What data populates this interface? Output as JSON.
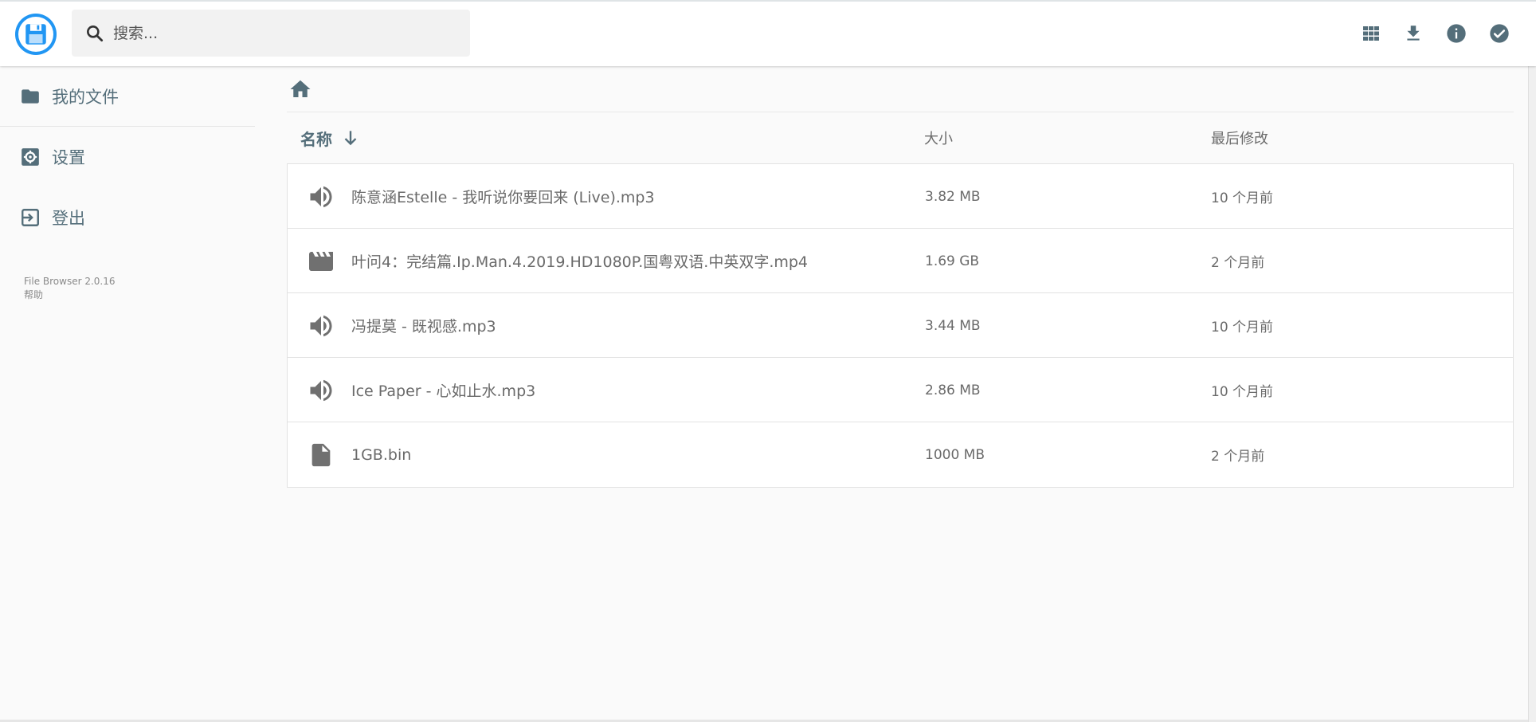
{
  "header": {
    "search_placeholder": "搜索...",
    "actions": [
      {
        "icon": "grid-view-icon"
      },
      {
        "icon": "download-icon"
      },
      {
        "icon": "info-icon"
      },
      {
        "icon": "check-circle-icon"
      }
    ],
    "accent_color": "#2196f3"
  },
  "sidebar": {
    "items": [
      {
        "label": "我的文件",
        "icon": "folder-icon"
      },
      {
        "label": "设置",
        "icon": "settings-icon"
      },
      {
        "label": "登出",
        "icon": "logout-icon"
      }
    ],
    "version": "File Browser 2.0.16",
    "help": "帮助"
  },
  "columns": {
    "name": "名称",
    "size": "大小",
    "modified": "最后修改"
  },
  "files": [
    {
      "name": "陈意涵Estelle - 我听说你要回来 (Live).mp3",
      "size": "3.82 MB",
      "modified": "10 个月前",
      "icon": "audio-icon"
    },
    {
      "name": "叶问4：完结篇.Ip.Man.4.2019.HD1080P.国粤双语.中英双字.mp4",
      "size": "1.69 GB",
      "modified": "2 个月前",
      "icon": "movie-icon"
    },
    {
      "name": "冯提莫 - 既视感.mp3",
      "size": "3.44 MB",
      "modified": "10 个月前",
      "icon": "audio-icon"
    },
    {
      "name": "Ice Paper - 心如止水.mp3",
      "size": "2.86 MB",
      "modified": "10 个月前",
      "icon": "audio-icon"
    },
    {
      "name": "1GB.bin",
      "size": "1000 MB",
      "modified": "2 个月前",
      "icon": "file-icon"
    }
  ]
}
